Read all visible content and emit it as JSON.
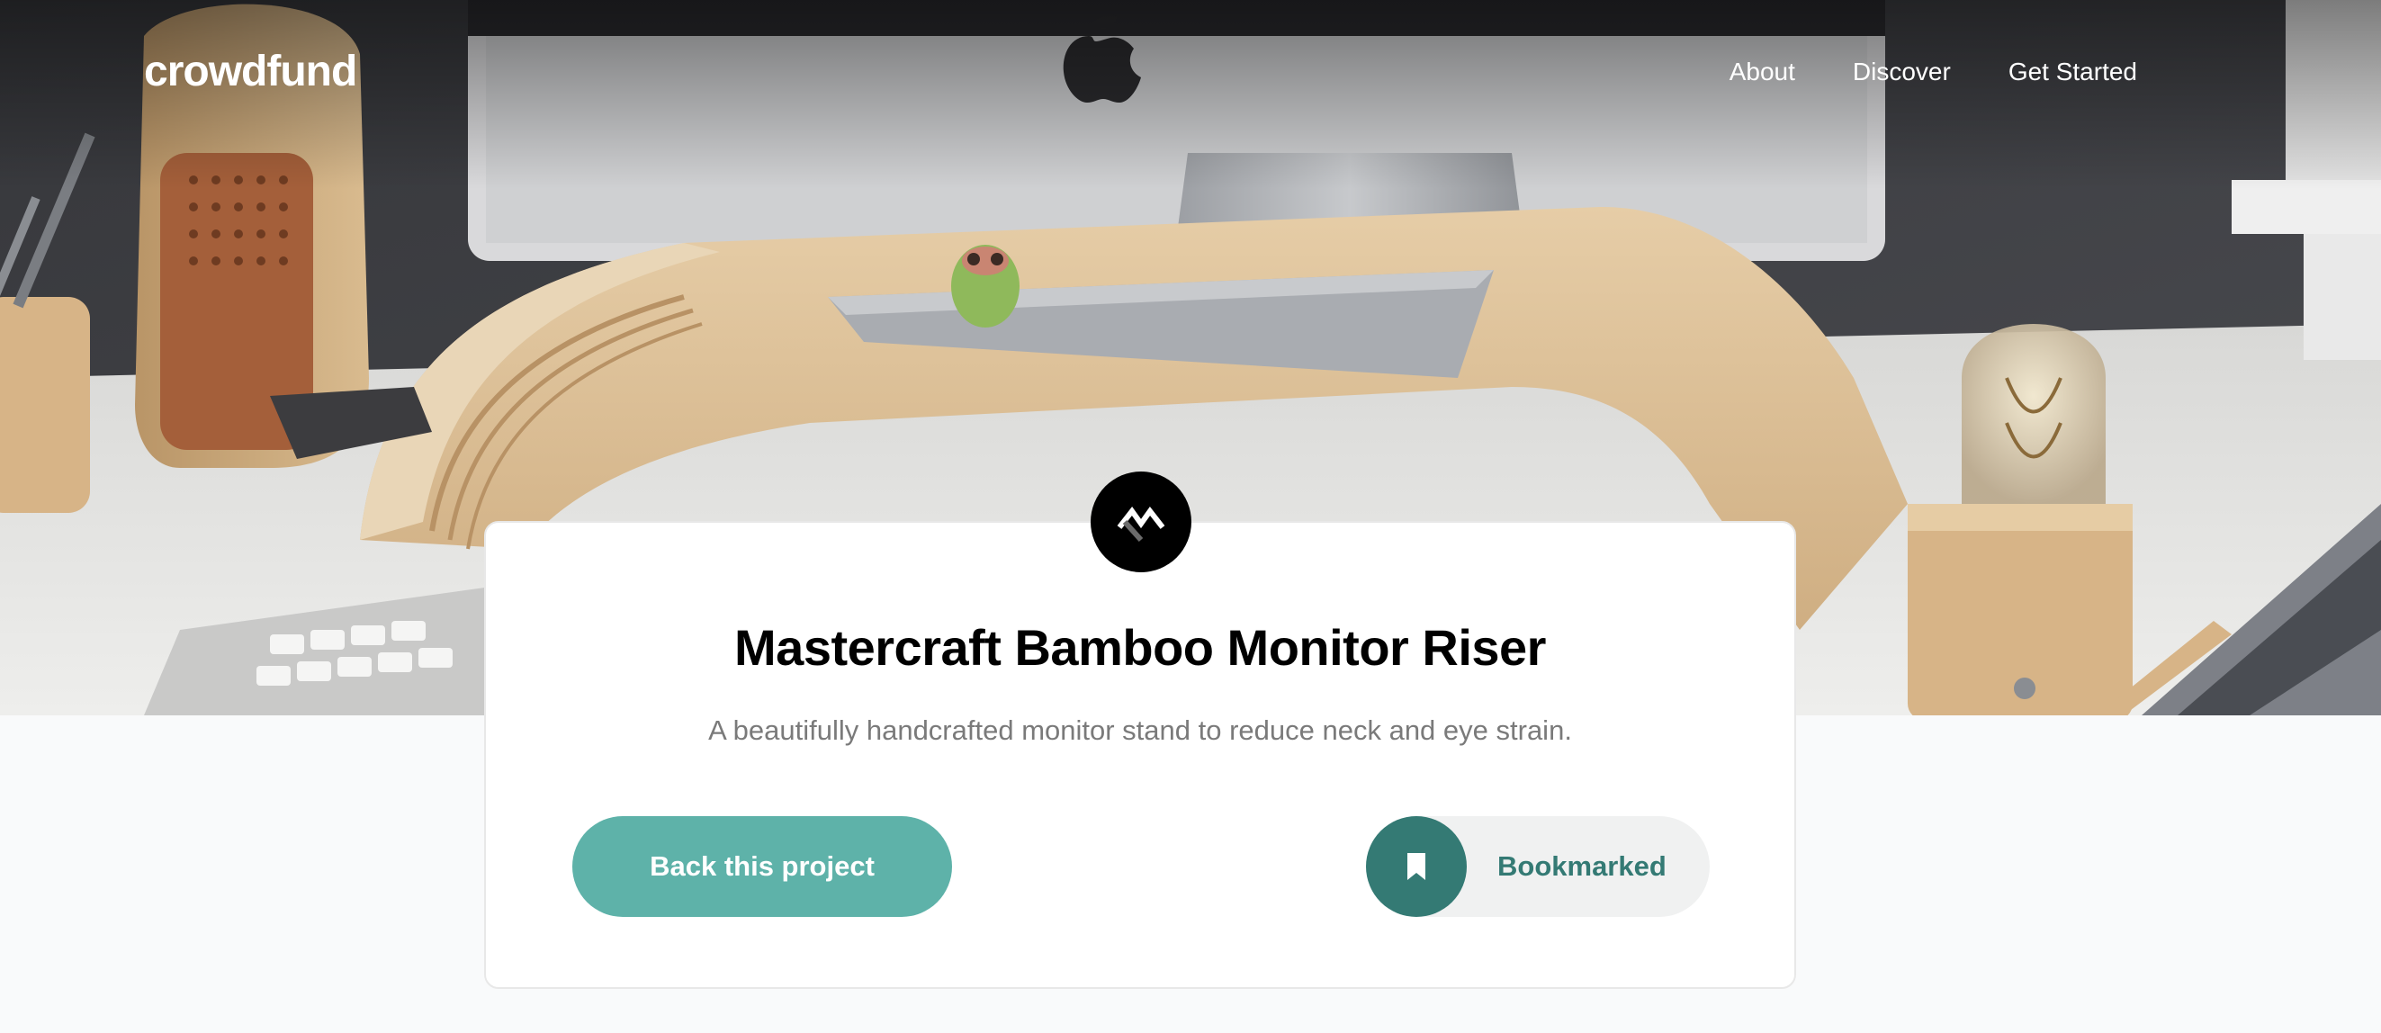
{
  "header": {
    "logo": "crowdfund",
    "nav": [
      {
        "label": "About"
      },
      {
        "label": "Discover"
      },
      {
        "label": "Get Started"
      }
    ]
  },
  "hero": {
    "image_icon": "desk-setup-photo"
  },
  "project": {
    "logo_icon": "mastercraft-logo-icon",
    "title": "Mastercraft Bamboo Monitor Riser",
    "description": "A beautifully handcrafted monitor stand to reduce neck and eye strain.",
    "back_label": "Back this project",
    "bookmark_label": "Bookmarked",
    "bookmark_icon": "bookmark-icon"
  },
  "colors": {
    "primary": "#5eb2a9",
    "primary_dark": "#347a74",
    "bookmark_bg": "#f0f1f1",
    "page_bg": "#f9fafb",
    "text_muted": "#7a7a7a"
  }
}
